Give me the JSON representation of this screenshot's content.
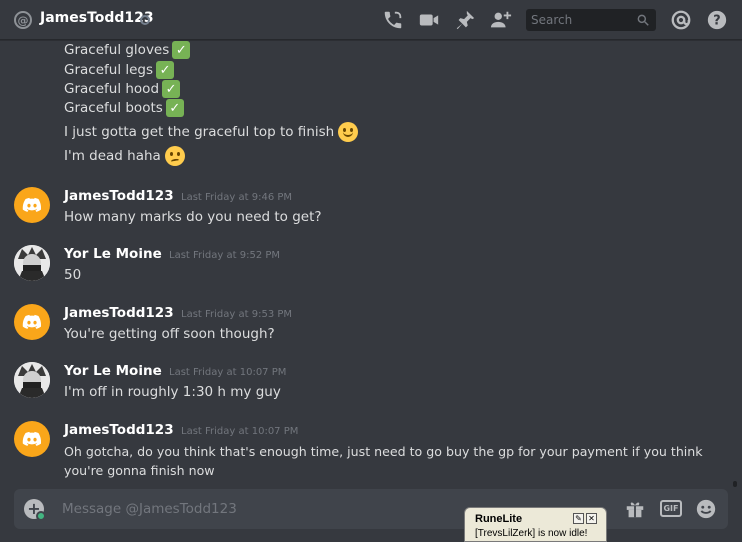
{
  "header": {
    "channel_name": "JamesTodd123",
    "search_placeholder": "Search",
    "icons": [
      "at-icon",
      "call-icon",
      "video-icon",
      "pin-icon",
      "add-friend-icon",
      "search-icon",
      "mention-icon",
      "help-icon"
    ]
  },
  "continuation_lines": [
    "Graceful gloves",
    "Graceful legs",
    "Graceful hood",
    "Graceful boots",
    "I just gotta get the graceful top to finish",
    "I'm dead haha"
  ],
  "messages": [
    {
      "author": "JamesTodd123",
      "timestamp": "Last Friday at 9:46 PM",
      "lines": [
        "How many marks do you need to get?"
      ],
      "avatar": "discord"
    },
    {
      "author": "Yor Le Moine",
      "timestamp": "Last Friday at 9:52 PM",
      "lines": [
        "50"
      ],
      "avatar": "user"
    },
    {
      "author": "JamesTodd123",
      "timestamp": "Last Friday at 9:53 PM",
      "lines": [
        "You're getting off soon though?"
      ],
      "avatar": "discord"
    },
    {
      "author": "Yor Le Moine",
      "timestamp": "Last Friday at 10:07 PM",
      "lines": [
        "I'm off in roughly 1:30 h my guy"
      ],
      "avatar": "user"
    },
    {
      "author": "JamesTodd123",
      "timestamp": "Last Friday at 10:07 PM",
      "lines": [
        "Oh gotcha, do you think that's enough time, just need to go buy the gp for your payment if you think",
        "you're gonna finish now"
      ],
      "avatar": "discord"
    }
  ],
  "composer": {
    "placeholder": "Message @JamesTodd123",
    "gif_label": "GIF"
  },
  "notification": {
    "title": "RuneLite",
    "body": "[TrevsLilZerk] is now idle!"
  },
  "colors": {
    "background": "#36393f",
    "discord_avatar": "#faa61a",
    "check_emoji": "#77b255"
  }
}
